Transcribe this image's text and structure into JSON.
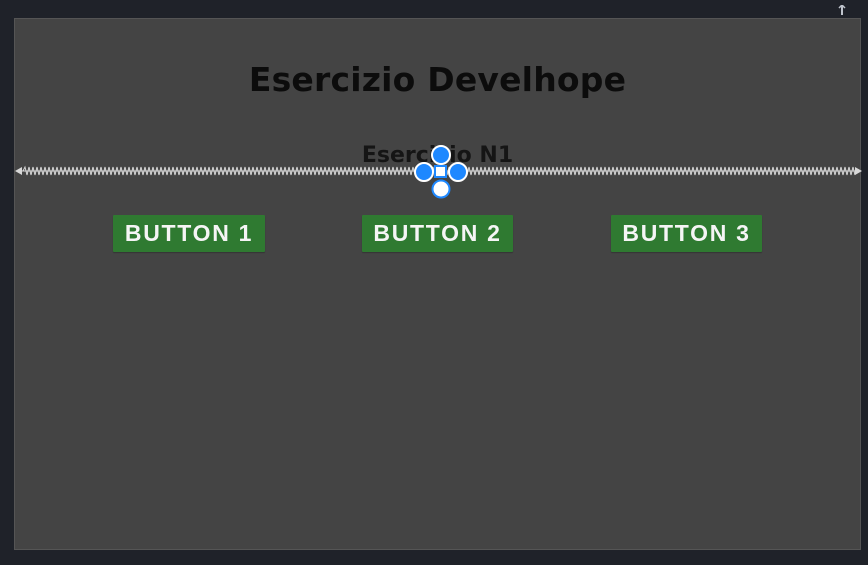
{
  "screen": {
    "title": "Esercizio Develhope",
    "subtitle": "Esercizio N1"
  },
  "buttons": [
    {
      "label": "BUTTON 1"
    },
    {
      "label": "BUTTON 2"
    },
    {
      "label": "BUTTON 3"
    }
  ],
  "colors": {
    "background": "#1f2229",
    "canvas": "#444444",
    "title": "#0c0c0c",
    "button": "#2f7a31",
    "button_text": "#f5f5f5",
    "selection_accent": "#1e88ff"
  },
  "icons": {
    "selection": "selection-handle-icon",
    "constraint": "horizontal-constraint-icon",
    "top_handle": "top-handle-icon"
  }
}
